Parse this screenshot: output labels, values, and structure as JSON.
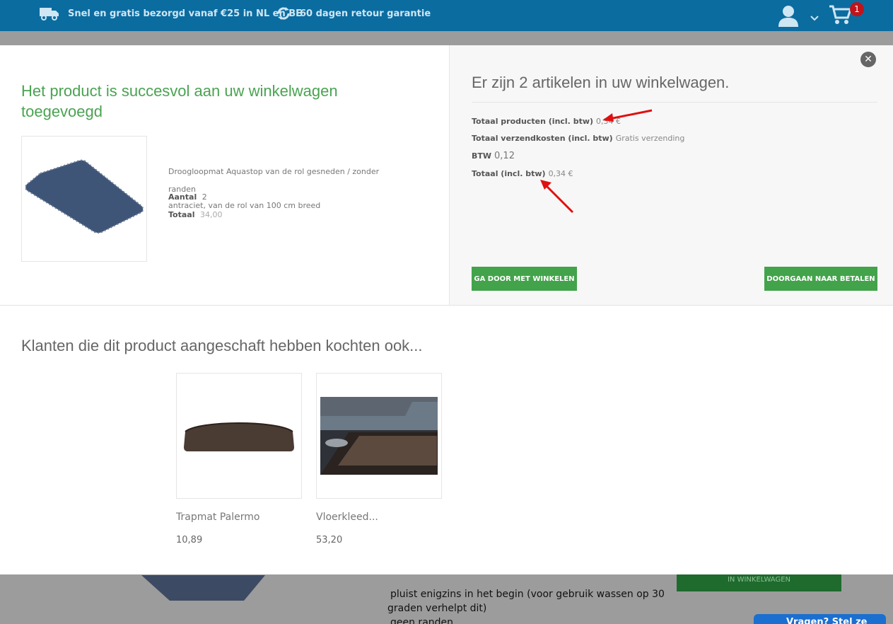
{
  "topbar": {
    "usp_shipping": "Snel en gratis bezorgd vanaf €25 in NL en BE",
    "usp_return": "60 dagen retour garantie",
    "cart_count": "1"
  },
  "modal": {
    "close_label": "✕",
    "success_title": "Het product is succesvol aan uw winkelwagen toegevoegd",
    "product": {
      "name_line1": "Droogloopmat Aquastop van de rol gesneden / zonder randen",
      "name_line2": "antraciet, van de rol van 100 cm breed",
      "qty_label": "Aantal",
      "qty_value": "2",
      "total_label": "Totaal",
      "total_value": "34,00"
    },
    "cart_summary": "Er zijn 2 artikelen in uw winkelwagen.",
    "totals": {
      "products_label": "Totaal producten (incl. btw)",
      "products_value": "0,34 €",
      "shipping_label": "Totaal verzendkosten (incl. btw)",
      "shipping_value": "Gratis verzending",
      "vat_label": "BTW",
      "vat_value": "0,12",
      "total_label": "Totaal (incl. btw)",
      "total_value": "0,34 €"
    },
    "continue_button": "GA DOOR MET WINKELEN",
    "checkout_button": "DOORGAAN NAAR BETALEN",
    "also_bought_title": "Klanten die dit product aangeschaft hebben kochten ook...",
    "also_bought": [
      {
        "name": "Trapmat Palermo",
        "price": "10,89"
      },
      {
        "name": "Vloerkleed...",
        "price": "53,20"
      }
    ]
  },
  "background": {
    "cart_button": "IN WINKELWAGEN",
    "text_line1": "pluist enigzins in het begin (voor gebruik wassen op 30",
    "text_line2": "graden verhelpt dit)",
    "text_line3": "geen randen",
    "chat_label": "Vragen? Stel ze gul"
  },
  "colors": {
    "topbar": "#0b6ca0",
    "success_green": "#4aa351",
    "button_green": "#43a34b",
    "annotation_red": "#e01010",
    "badge_red": "#c0141c"
  }
}
